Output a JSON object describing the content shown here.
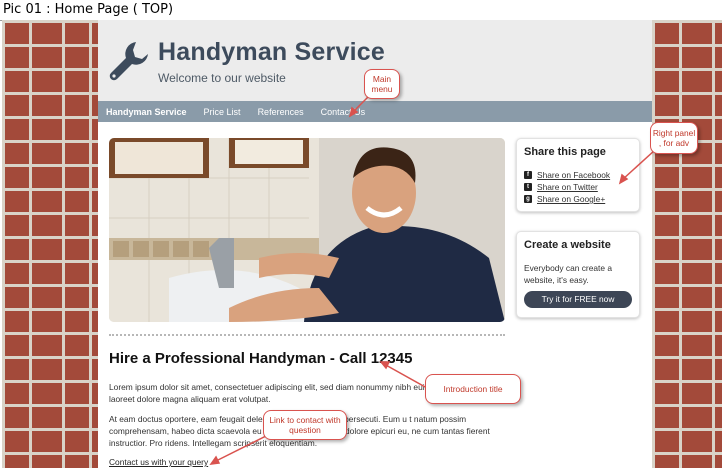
{
  "caption": "Pic 01 : Home Page ( TOP)",
  "header": {
    "title": "Handyman Service",
    "subtitle": "Welcome to our website"
  },
  "nav": {
    "items": [
      "Handyman Service",
      "Price List",
      "References",
      "Contact Us"
    ]
  },
  "main": {
    "intro_title": "Hire a Professional Handyman - Call 12345",
    "para1": "Lorem ipsum dolor sit amet, consectetuer adipiscing elit, sed diam nonummy nibh euismod tincidunt ut laoreet dolore magna aliquam erat volutpat.",
    "para2": "At eam doctus oportere, eam feugait delectus ne. Cu qui lorem persecuti. Eum u t natum possim comprehensam, habeo dicta scaevola eu nec. Nam tantas. Pro dolore epicuri eu, ne cum tantas fierent instructior. Pro ridens. Intellegam scripserit eloquentiam.",
    "contact_link": "Contact us with your query"
  },
  "sidebar": {
    "share": {
      "title": "Share this page",
      "facebook": "Share on Facebook",
      "twitter": "Share on Twitter",
      "google": "Share on Google+"
    },
    "create": {
      "title": "Create a website",
      "text": "Everybody can create a website, it's easy.",
      "button": "Try it for FREE now"
    }
  },
  "annotations": {
    "main_menu": "Main menu",
    "right_panel": "Right panel , for adv",
    "intro_title": "Introduction title",
    "link": "Link to contact with question"
  },
  "colors": {
    "nav_bg": "#8a9ba9",
    "title_color": "#3d4b5c",
    "button_bg": "#3d4656",
    "annotation_red": "#d9534f"
  }
}
